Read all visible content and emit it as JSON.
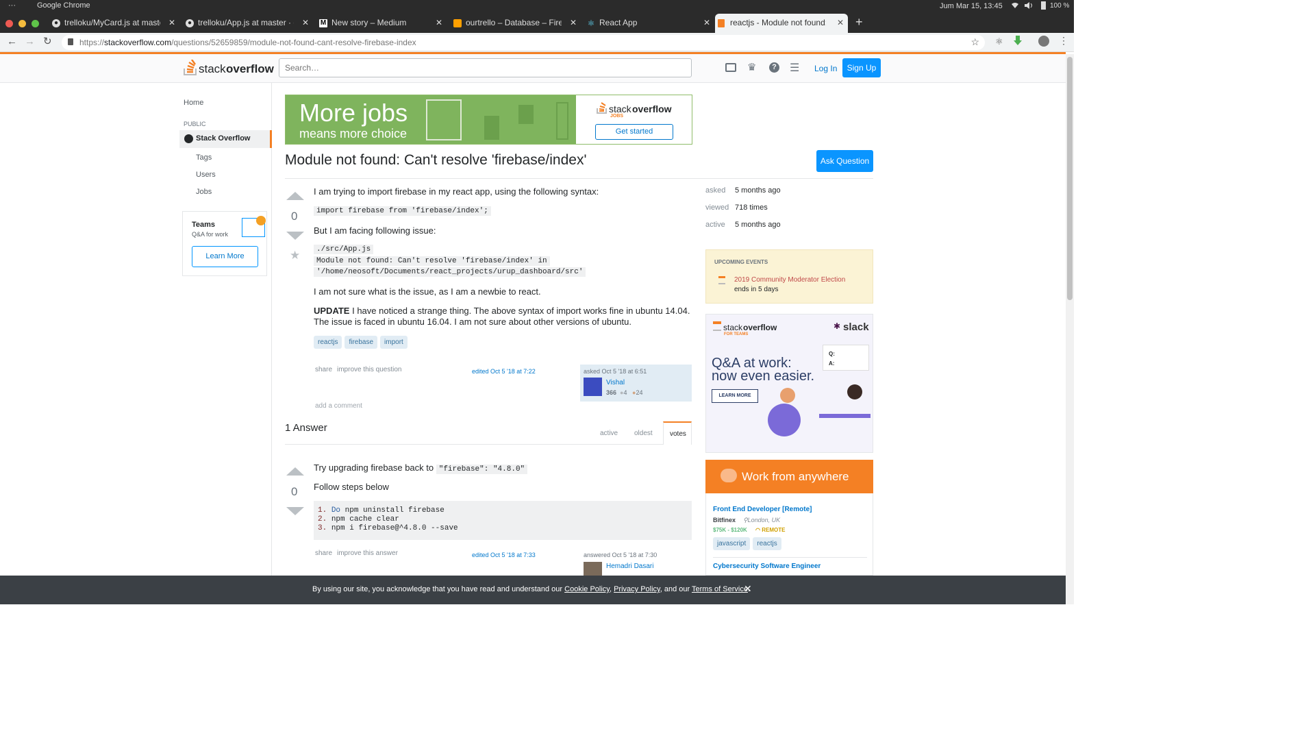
{
  "system": {
    "dots": "···",
    "app": "Google Chrome",
    "datetime": "Jum Mar 15, 13:45",
    "battery": "100 %"
  },
  "tabs": [
    {
      "label": "trelloku/MyCard.js at maste",
      "icon": "github-icon"
    },
    {
      "label": "trelloku/App.js at master · c",
      "icon": "github-icon"
    },
    {
      "label": "New story – Medium",
      "icon": "medium-icon"
    },
    {
      "label": "ourtrello – Database – Fireb",
      "icon": "firebase-icon"
    },
    {
      "label": "React App",
      "icon": "react-icon"
    },
    {
      "label": "reactjs - Module not found: C",
      "icon": "stackoverflow-icon"
    }
  ],
  "url": {
    "prefix": "https://",
    "domain": "stackoverflow.com",
    "path": "/questions/52659859/module-not-found-cant-resolve-firebase-index"
  },
  "header": {
    "logo_a": "stack",
    "logo_b": "overflow",
    "search_placeholder": "Search…",
    "login": "Log In",
    "signup": "Sign Up"
  },
  "nav": {
    "home": "Home",
    "public": "PUBLIC",
    "so": "Stack Overflow",
    "tags": "Tags",
    "users": "Users",
    "jobs": "Jobs",
    "teams": "Teams",
    "teams_sub": "Q&A for work",
    "learn": "Learn More"
  },
  "banner": {
    "line1": "More jobs",
    "line2": "means more choice",
    "logo_a": "stack",
    "logo_b": "overflow",
    "logo_sub": "JOBS",
    "cta": "Get started"
  },
  "question": {
    "title": "Module not found: Can't resolve 'firebase/index'",
    "ask_button": "Ask Question",
    "votes": "0",
    "p1": "I am trying to import firebase in my react app, using the following syntax:",
    "code1": "import firebase from 'firebase/index';",
    "p2": "But I am facing following issue:",
    "code2_l1": "./src/App.js",
    "code2_l2": "Module not found: Can't resolve 'firebase/index' in",
    "code2_l3": "'/home/neosoft/Documents/react_projects/urup_dashboard/src'",
    "p3": "I am not sure what is the issue, as I am a newbie to react.",
    "update_bold": "UPDATE",
    "update_text": " I have noticed a strange thing. The above syntax of import works fine in ubuntu 14.04. The issue is faced in ubuntu 16.04. I am not sure about other versions of ubuntu.",
    "tags": [
      "reactjs",
      "firebase",
      "import"
    ],
    "share": "share",
    "improve": "improve this question",
    "edited": "edited Oct 5 '18 at 7:22",
    "asked": "asked Oct 5 '18 at 6:51",
    "user": "Vishal",
    "rep": "366",
    "silver": "4",
    "bronze": "24",
    "add_comment": "add a comment"
  },
  "stats": {
    "asked_l": "asked",
    "asked_v": "5 months ago",
    "viewed_l": "viewed",
    "viewed_v": "718 times",
    "active_l": "active",
    "active_v": "5 months ago"
  },
  "events": {
    "title": "UPCOMING EVENTS",
    "name": "2019 Community Moderator Election",
    "ends": "ends in 5 days"
  },
  "teams_ad": {
    "logo_a": "stack",
    "logo_b": "overflow",
    "logo_sub": "FOR TEAMS",
    "slack": "slack",
    "line1": "Q&A at work:",
    "line2": "now even easier.",
    "cta": "LEARN MORE",
    "q": "Q:",
    "a": "A:"
  },
  "answers": {
    "count": "1 Answer",
    "sort": [
      "active",
      "oldest",
      "votes"
    ]
  },
  "answer": {
    "votes": "0",
    "p1": "Try upgrading firebase back to ",
    "code_inline": "\"firebase\": \"4.8.0\"",
    "p2": "Follow steps below",
    "lines": [
      {
        "n": "1.",
        "kw": "Do",
        "rest": " npm uninstall firebase"
      },
      {
        "n": "2.",
        "kw": "",
        "rest": "npm cache clear"
      },
      {
        "n": "3.",
        "kw": "",
        "rest": "npm i firebase@^4.8.0 --save"
      }
    ],
    "share": "share",
    "improve": "improve this answer",
    "edited": "edited Oct 5 '18 at 7:33",
    "answered": "answered Oct 5 '18 at 7:30",
    "user": "Hemadri Dasari"
  },
  "jobs": {
    "header": "Work from anywhere",
    "job1_title": "Front End Developer [Remote]",
    "job1_company": "Bitfinex",
    "job1_loc": "London, UK",
    "job1_salary": "$75K - $120K",
    "job1_remote": "REMOTE",
    "job1_tags": [
      "javascript",
      "reactjs"
    ],
    "job2_title": "Cybersecurity Software Engineer"
  },
  "cookie": {
    "pre": "By using our site, you acknowledge that you have read and understand our ",
    "l1": "Cookie Policy",
    ",": ", ",
    "l2": "Privacy Policy",
    "mid": ", and our ",
    "l3": "Terms of Service",
    "end": "."
  },
  "colors": {
    "accent": "#f48024",
    "link": "#0077cc",
    "button": "#0a95ff",
    "chrome_dark": "#2b2b2b"
  }
}
